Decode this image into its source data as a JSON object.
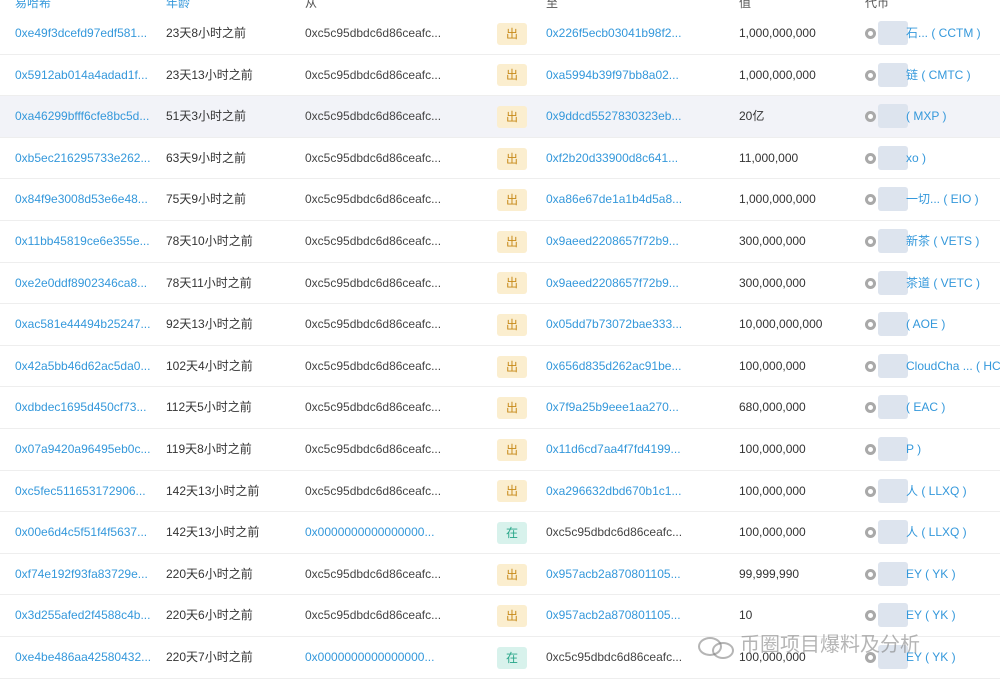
{
  "header": {
    "hash": "易哈希",
    "age": "年龄",
    "from": "从",
    "to": "至",
    "quantity": "值",
    "token": "代币"
  },
  "rows": [
    {
      "hash": "0xe49f3dcefd97edf581...",
      "age": "23天8小时之前",
      "from": "0xc5c95dbdc6d86ceafc...",
      "from_link": false,
      "dir": "出",
      "dir_type": "out",
      "to": "0x226f5ecb03041b98f2...",
      "to_link": true,
      "quantity": "1,000,000,000",
      "token": "石... ( CCTM )",
      "highlight": false
    },
    {
      "hash": "0x5912ab014a4adad1f...",
      "age": "23天13小时之前",
      "from": "0xc5c95dbdc6d86ceafc...",
      "from_link": false,
      "dir": "出",
      "dir_type": "out",
      "to": "0xa5994b39f97bb8a02...",
      "to_link": true,
      "quantity": "1,000,000,000",
      "token": "链 ( CMTC )",
      "highlight": false
    },
    {
      "hash": "0xa46299bfff6cfe8bc5d...",
      "age": "51天3小时之前",
      "from": "0xc5c95dbdc6d86ceafc...",
      "from_link": false,
      "dir": "出",
      "dir_type": "out",
      "to": "0x9ddcd5527830323eb...",
      "to_link": true,
      "quantity": "20亿",
      "token": "( MXP )",
      "highlight": true
    },
    {
      "hash": "0xb5ec216295733e262...",
      "age": "63天9小时之前",
      "from": "0xc5c95dbdc6d86ceafc...",
      "from_link": false,
      "dir": "出",
      "dir_type": "out",
      "to": "0xf2b20d33900d8c641...",
      "to_link": true,
      "quantity": "11,000,000",
      "token": "xo )",
      "highlight": false
    },
    {
      "hash": "0x84f9e3008d53e6e48...",
      "age": "75天9小时之前",
      "from": "0xc5c95dbdc6d86ceafc...",
      "from_link": false,
      "dir": "出",
      "dir_type": "out",
      "to": "0xa86e67de1a1b4d5a8...",
      "to_link": true,
      "quantity": "1,000,000,000",
      "token": "一切... ( EIO )",
      "highlight": false
    },
    {
      "hash": "0x11bb45819ce6e355e...",
      "age": "78天10小时之前",
      "from": "0xc5c95dbdc6d86ceafc...",
      "from_link": false,
      "dir": "出",
      "dir_type": "out",
      "to": "0x9aeed2208657f72b9...",
      "to_link": true,
      "quantity": "300,000,000",
      "token": "新茶 ( VETS )",
      "highlight": false
    },
    {
      "hash": "0xe2e0ddf8902346ca8...",
      "age": "78天11小时之前",
      "from": "0xc5c95dbdc6d86ceafc...",
      "from_link": false,
      "dir": "出",
      "dir_type": "out",
      "to": "0x9aeed2208657f72b9...",
      "to_link": true,
      "quantity": "300,000,000",
      "token": "茶道 ( VETC )",
      "highlight": false
    },
    {
      "hash": "0xac581e44494b25247...",
      "age": "92天13小时之前",
      "from": "0xc5c95dbdc6d86ceafc...",
      "from_link": false,
      "dir": "出",
      "dir_type": "out",
      "to": "0x05dd7b73072bae333...",
      "to_link": true,
      "quantity": "10,000,000,000",
      "token": "( AOE )",
      "highlight": false
    },
    {
      "hash": "0x42a5bb46d62ac5da0...",
      "age": "102天4小时之前",
      "from": "0xc5c95dbdc6d86ceafc...",
      "from_link": false,
      "dir": "出",
      "dir_type": "out",
      "to": "0x656d835d262ac91be...",
      "to_link": true,
      "quantity": "100,000,000",
      "token": "CloudCha ... ( HC)",
      "highlight": false
    },
    {
      "hash": "0xdbdec1695d450cf73...",
      "age": "112天5小时之前",
      "from": "0xc5c95dbdc6d86ceafc...",
      "from_link": false,
      "dir": "出",
      "dir_type": "out",
      "to": "0x7f9a25b9eee1aa270...",
      "to_link": true,
      "quantity": "680,000,000",
      "token": "( EAC )",
      "highlight": false
    },
    {
      "hash": "0x07a9420a96495eb0c...",
      "age": "119天8小时之前",
      "from": "0xc5c95dbdc6d86ceafc...",
      "from_link": false,
      "dir": "出",
      "dir_type": "out",
      "to": "0x11d6cd7aa4f7fd4199...",
      "to_link": true,
      "quantity": "100,000,000",
      "token": "P )",
      "highlight": false
    },
    {
      "hash": "0xc5fec511653172906...",
      "age": "142天13小时之前",
      "from": "0xc5c95dbdc6d86ceafc...",
      "from_link": false,
      "dir": "出",
      "dir_type": "out",
      "to": "0xa296632dbd670b1c1...",
      "to_link": true,
      "quantity": "100,000,000",
      "token": "人 ( LLXQ )",
      "highlight": false
    },
    {
      "hash": "0x00e6d4c5f51f4f5637...",
      "age": "142天13小时之前",
      "from": "0x0000000000000000...",
      "from_link": true,
      "dir": "在",
      "dir_type": "in",
      "to": "0xc5c95dbdc6d86ceafc...",
      "to_link": false,
      "quantity": "100,000,000",
      "token": "人 ( LLXQ )",
      "highlight": false
    },
    {
      "hash": "0xf74e192f93fa83729e...",
      "age": "220天6小时之前",
      "from": "0xc5c95dbdc6d86ceafc...",
      "from_link": false,
      "dir": "出",
      "dir_type": "out",
      "to": "0x957acb2a870801105...",
      "to_link": true,
      "quantity": "99,999,990",
      "token": "EY ( YK )",
      "highlight": false
    },
    {
      "hash": "0x3d255afed2f4588c4b...",
      "age": "220天6小时之前",
      "from": "0xc5c95dbdc6d86ceafc...",
      "from_link": false,
      "dir": "出",
      "dir_type": "out",
      "to": "0x957acb2a870801105...",
      "to_link": true,
      "quantity": "10",
      "token": "EY ( YK )",
      "highlight": false
    },
    {
      "hash": "0xe4be486aa42580432...",
      "age": "220天7小时之前",
      "from": "0x0000000000000000...",
      "from_link": true,
      "dir": "在",
      "dir_type": "in",
      "to": "0xc5c95dbdc6d86ceafc...",
      "to_link": false,
      "quantity": "100,000,000",
      "token": "EY ( YK )",
      "highlight": false
    }
  ],
  "watermark": "币圈项目爆料及分析",
  "colors": {
    "link": "#3498db",
    "badge_out_bg": "#fbeecf",
    "badge_out_fg": "#c78a19",
    "badge_in_bg": "#d8f2ec",
    "badge_in_fg": "#27a688",
    "row_highlight": "#f2f3f8"
  }
}
